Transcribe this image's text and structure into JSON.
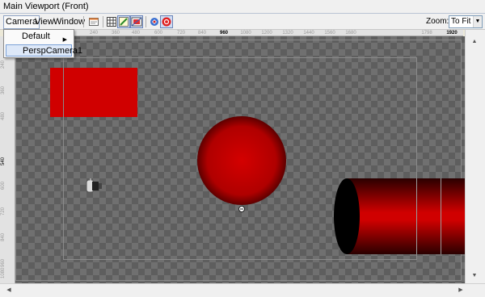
{
  "window": {
    "title": "Main Viewport (Front)"
  },
  "menu": {
    "camera": "Camera",
    "view": "View",
    "window": "Window"
  },
  "toolbar": {
    "icons": [
      "frame-icon",
      "grid-icon",
      "edit-toggle-icon",
      "safe-frame-icon",
      "snap-icon",
      "record-icon"
    ]
  },
  "zoom": {
    "label": "Zoom:",
    "value": "To Fit"
  },
  "ruler": {
    "top_ticks": [
      "240",
      "360",
      "480",
      "600",
      "720",
      "840",
      "960",
      "1080",
      "1200",
      "1320",
      "1440",
      "1560",
      "1680",
      "1798",
      "1920"
    ],
    "top_highlight": [
      "960",
      "1920"
    ],
    "left_ticks": [
      "240",
      "360",
      "480",
      "540",
      "600",
      "720",
      "840",
      "960",
      "1080"
    ],
    "left_highlight": [
      "540"
    ]
  },
  "camera_menu": {
    "items": [
      {
        "label": "Default",
        "has_submenu": true
      },
      {
        "label": "PerspCamera1",
        "selected": true
      }
    ]
  },
  "colors": {
    "red_object": "#d00000",
    "checker_dark": "#5e5e5e",
    "checker_light": "#707070",
    "selection_border": "#7aa0d6"
  }
}
